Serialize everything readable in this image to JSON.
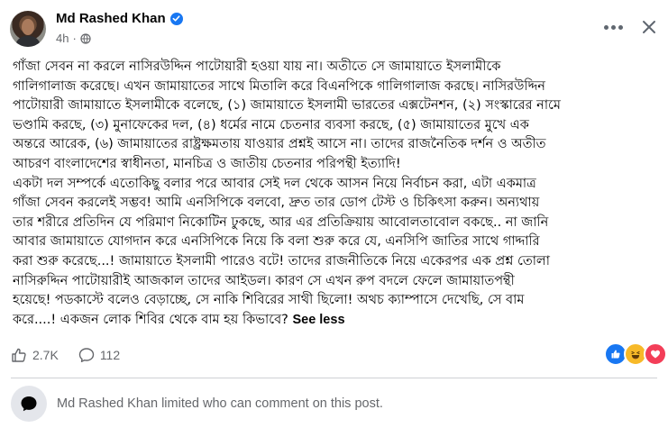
{
  "post": {
    "author": "Md Rashed Khan",
    "time": "4h",
    "body_lines": [
      "গাঁজা সেবন না করলে নাসিরউদ্দিন পাটোয়ারী হওয়া যায় না। অতীতে সে জামায়াতে ইসলামীকে",
      "গালিগালাজ করেছে। এখন জামায়াতের সাথে মিতালি করে বিএনপিকে গালিগালাজ করছে। নাসিরউদ্দিন",
      "পাটোয়ারী জামায়াতে ইসলামীকে বলেছে, (১) জামায়াতে ইসলামী ভারতের এক্সটেনশন, (২) সংস্কারের নামে",
      "ভণ্ডামি করছে, (৩) মুনাফেকের দল, (৪) ধর্মের নামে চেতনার ব্যবসা করছে, (৫) জামায়াতের মুখে এক",
      "অন্তরে আরেক, (৬) জামায়াতের রাষ্ট্রক্ষমতায় যাওয়ার প্রশ্নই আসে না। তাদের রাজনৈতিক দর্শন ও অতীত",
      "আচরণ বাংলাদেশের স্বাধীনতা, মানচিত্র ও জাতীয় চেতনার পরিপন্থী ইত্যাদি!",
      "একটা দল সম্পর্কে এতোকিছু বলার পরে আবার সেই দল থেকে আসন নিয়ে নির্বাচন করা, এটা একমাত্র",
      "গাঁজা সেবন করলেই সম্ভব! আমি এনসিপিকে বলবো, দ্রুত তার ডোপ টেস্ট ও চিকিৎসা করুন। অন্যথায়",
      "তার শরীরে প্রতিদিন যে পরিমাণ নিকোটিন ঢুকছে, আর এর প্রতিক্রিয়ায় আবোলতাবোল বকছে.. না জানি",
      "আবার জামায়াতে যোগদান করে এনসিপিকে নিয়ে কি বলা শুরু করে যে, এনসিপি জাতির সাথে গাদ্দারি",
      "করা শুরু করেছে...! জামায়াতে ইসলামী পারেও বটে! তাদের রাজনীতিকে নিয়ে একেরপর এক প্রশ্ন তোলা",
      "নাসিরুদ্দিন পাটোয়ারীই আজকাল তাদের আইডল। কারণ সে এখন রুপ বদলে ফেলে জামায়াতপন্থী",
      "হয়েছে! পডকাস্টে বলেও বেড়াচ্ছে, সে নাকি শিবিরের সাথী ছিলো! অথচ ক্যাম্পাসে দেখেছি, সে বাম",
      "করে....! একজন লোক শিবির থেকে বাম হয় কিভাবে?"
    ],
    "see_less": "See less",
    "likes_count": "2.7K",
    "comments_count": "112",
    "reaction_icons": [
      "like-icon",
      "haha-icon",
      "love-icon"
    ],
    "footer_notice": "Md Rashed Khan limited who can comment on this post."
  },
  "colors": {
    "verified": "#1877f2",
    "secondary_text": "#65676b",
    "like": "#1877f2",
    "haha": "#f7b928",
    "love": "#f33e58"
  }
}
